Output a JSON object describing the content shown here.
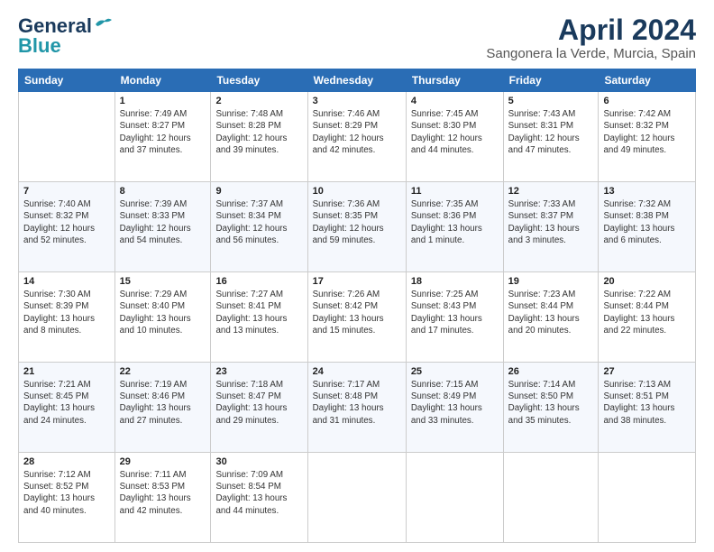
{
  "header": {
    "logo_general": "General",
    "logo_blue": "Blue",
    "title": "April 2024",
    "subtitle": "Sangonera la Verde, Murcia, Spain"
  },
  "calendar": {
    "columns": [
      "Sunday",
      "Monday",
      "Tuesday",
      "Wednesday",
      "Thursday",
      "Friday",
      "Saturday"
    ],
    "weeks": [
      {
        "days": [
          {
            "num": "",
            "info": ""
          },
          {
            "num": "1",
            "info": "Sunrise: 7:49 AM\nSunset: 8:27 PM\nDaylight: 12 hours\nand 37 minutes."
          },
          {
            "num": "2",
            "info": "Sunrise: 7:48 AM\nSunset: 8:28 PM\nDaylight: 12 hours\nand 39 minutes."
          },
          {
            "num": "3",
            "info": "Sunrise: 7:46 AM\nSunset: 8:29 PM\nDaylight: 12 hours\nand 42 minutes."
          },
          {
            "num": "4",
            "info": "Sunrise: 7:45 AM\nSunset: 8:30 PM\nDaylight: 12 hours\nand 44 minutes."
          },
          {
            "num": "5",
            "info": "Sunrise: 7:43 AM\nSunset: 8:31 PM\nDaylight: 12 hours\nand 47 minutes."
          },
          {
            "num": "6",
            "info": "Sunrise: 7:42 AM\nSunset: 8:32 PM\nDaylight: 12 hours\nand 49 minutes."
          }
        ]
      },
      {
        "days": [
          {
            "num": "7",
            "info": "Sunrise: 7:40 AM\nSunset: 8:32 PM\nDaylight: 12 hours\nand 52 minutes."
          },
          {
            "num": "8",
            "info": "Sunrise: 7:39 AM\nSunset: 8:33 PM\nDaylight: 12 hours\nand 54 minutes."
          },
          {
            "num": "9",
            "info": "Sunrise: 7:37 AM\nSunset: 8:34 PM\nDaylight: 12 hours\nand 56 minutes."
          },
          {
            "num": "10",
            "info": "Sunrise: 7:36 AM\nSunset: 8:35 PM\nDaylight: 12 hours\nand 59 minutes."
          },
          {
            "num": "11",
            "info": "Sunrise: 7:35 AM\nSunset: 8:36 PM\nDaylight: 13 hours\nand 1 minute."
          },
          {
            "num": "12",
            "info": "Sunrise: 7:33 AM\nSunset: 8:37 PM\nDaylight: 13 hours\nand 3 minutes."
          },
          {
            "num": "13",
            "info": "Sunrise: 7:32 AM\nSunset: 8:38 PM\nDaylight: 13 hours\nand 6 minutes."
          }
        ]
      },
      {
        "days": [
          {
            "num": "14",
            "info": "Sunrise: 7:30 AM\nSunset: 8:39 PM\nDaylight: 13 hours\nand 8 minutes."
          },
          {
            "num": "15",
            "info": "Sunrise: 7:29 AM\nSunset: 8:40 PM\nDaylight: 13 hours\nand 10 minutes."
          },
          {
            "num": "16",
            "info": "Sunrise: 7:27 AM\nSunset: 8:41 PM\nDaylight: 13 hours\nand 13 minutes."
          },
          {
            "num": "17",
            "info": "Sunrise: 7:26 AM\nSunset: 8:42 PM\nDaylight: 13 hours\nand 15 minutes."
          },
          {
            "num": "18",
            "info": "Sunrise: 7:25 AM\nSunset: 8:43 PM\nDaylight: 13 hours\nand 17 minutes."
          },
          {
            "num": "19",
            "info": "Sunrise: 7:23 AM\nSunset: 8:44 PM\nDaylight: 13 hours\nand 20 minutes."
          },
          {
            "num": "20",
            "info": "Sunrise: 7:22 AM\nSunset: 8:44 PM\nDaylight: 13 hours\nand 22 minutes."
          }
        ]
      },
      {
        "days": [
          {
            "num": "21",
            "info": "Sunrise: 7:21 AM\nSunset: 8:45 PM\nDaylight: 13 hours\nand 24 minutes."
          },
          {
            "num": "22",
            "info": "Sunrise: 7:19 AM\nSunset: 8:46 PM\nDaylight: 13 hours\nand 27 minutes."
          },
          {
            "num": "23",
            "info": "Sunrise: 7:18 AM\nSunset: 8:47 PM\nDaylight: 13 hours\nand 29 minutes."
          },
          {
            "num": "24",
            "info": "Sunrise: 7:17 AM\nSunset: 8:48 PM\nDaylight: 13 hours\nand 31 minutes."
          },
          {
            "num": "25",
            "info": "Sunrise: 7:15 AM\nSunset: 8:49 PM\nDaylight: 13 hours\nand 33 minutes."
          },
          {
            "num": "26",
            "info": "Sunrise: 7:14 AM\nSunset: 8:50 PM\nDaylight: 13 hours\nand 35 minutes."
          },
          {
            "num": "27",
            "info": "Sunrise: 7:13 AM\nSunset: 8:51 PM\nDaylight: 13 hours\nand 38 minutes."
          }
        ]
      },
      {
        "days": [
          {
            "num": "28",
            "info": "Sunrise: 7:12 AM\nSunset: 8:52 PM\nDaylight: 13 hours\nand 40 minutes."
          },
          {
            "num": "29",
            "info": "Sunrise: 7:11 AM\nSunset: 8:53 PM\nDaylight: 13 hours\nand 42 minutes."
          },
          {
            "num": "30",
            "info": "Sunrise: 7:09 AM\nSunset: 8:54 PM\nDaylight: 13 hours\nand 44 minutes."
          },
          {
            "num": "",
            "info": ""
          },
          {
            "num": "",
            "info": ""
          },
          {
            "num": "",
            "info": ""
          },
          {
            "num": "",
            "info": ""
          }
        ]
      }
    ]
  }
}
